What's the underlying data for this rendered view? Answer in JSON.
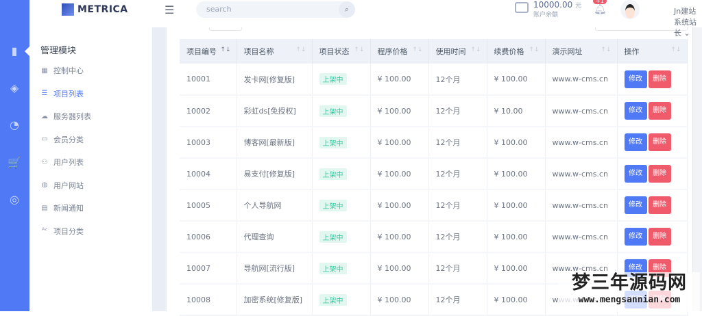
{
  "brand": {
    "name": "METRICA"
  },
  "search": {
    "placeholder": "search"
  },
  "header": {
    "balance": "10000.00",
    "currency": "元",
    "balance_label": "账户余额",
    "notification_badge": "+1",
    "username": "Jn建站系统站长"
  },
  "rail": {
    "icons": [
      "bar-chart-icon",
      "layers-icon",
      "pie-chart-icon",
      "cart-icon",
      "planet-icon"
    ]
  },
  "submenu": {
    "title": "管理模块",
    "items": [
      {
        "label": "控制中心",
        "icon": "grid-icon"
      },
      {
        "label": "项目列表",
        "icon": "database-icon",
        "active": true
      },
      {
        "label": "服务器列表",
        "icon": "cloud-icon"
      },
      {
        "label": "会员分类",
        "icon": "id-card-icon"
      },
      {
        "label": "用户列表",
        "icon": "users-icon"
      },
      {
        "label": "用户网站",
        "icon": "globe-icon"
      },
      {
        "label": "新闻通知",
        "icon": "document-icon"
      },
      {
        "label": "项目分类",
        "icon": "sort-az-icon"
      }
    ]
  },
  "table": {
    "columns": [
      "项目编号",
      "项目名称",
      "项目状态",
      "程序价格",
      "使用时间",
      "续费价格",
      "演示网址",
      "操作"
    ],
    "edit_label": "修改",
    "delete_label": "删除",
    "rows": [
      [
        "10001",
        "发卡网[修复版]",
        "上架中",
        "¥ 100.00",
        "12个月",
        "¥ 100.00",
        "www.w-cms.cn"
      ],
      [
        "10002",
        "彩虹ds[免授权]",
        "上架中",
        "¥ 100.00",
        "12个月",
        "¥ 10.00",
        "www.w-cms.cn"
      ],
      [
        "10003",
        "博客网[最新版]",
        "上架中",
        "¥ 100.00",
        "12个月",
        "¥ 100.00",
        "www.w-cms.cn"
      ],
      [
        "10004",
        "易支付[修复版]",
        "上架中",
        "¥ 100.00",
        "12个月",
        "¥ 100.00",
        "www.w-cms.cn"
      ],
      [
        "10005",
        "个人导航网",
        "上架中",
        "¥ 100.00",
        "12个月",
        "¥ 100.00",
        "www.w-cms.cn"
      ],
      [
        "10006",
        "代理查询",
        "上架中",
        "¥ 100.00",
        "12个月",
        "¥ 100.00",
        "www.w-cms.cn"
      ],
      [
        "10007",
        "导航网[流行版]",
        "上架中",
        "¥ 100.00",
        "12个月",
        "¥ 100.00",
        "www.w-cms.cn"
      ],
      [
        "10008",
        "加密系统[修复版]",
        "上架中",
        "¥ 100.00",
        "12个月",
        "¥ 100.00",
        "www.w-cms.cn"
      ]
    ]
  },
  "watermark": {
    "title": "梦三年源码网",
    "url": "www.mengsannian.com"
  },
  "colors": {
    "primary": "#5079f5",
    "danger": "#f05b6c",
    "success": "#2fc9a0"
  }
}
